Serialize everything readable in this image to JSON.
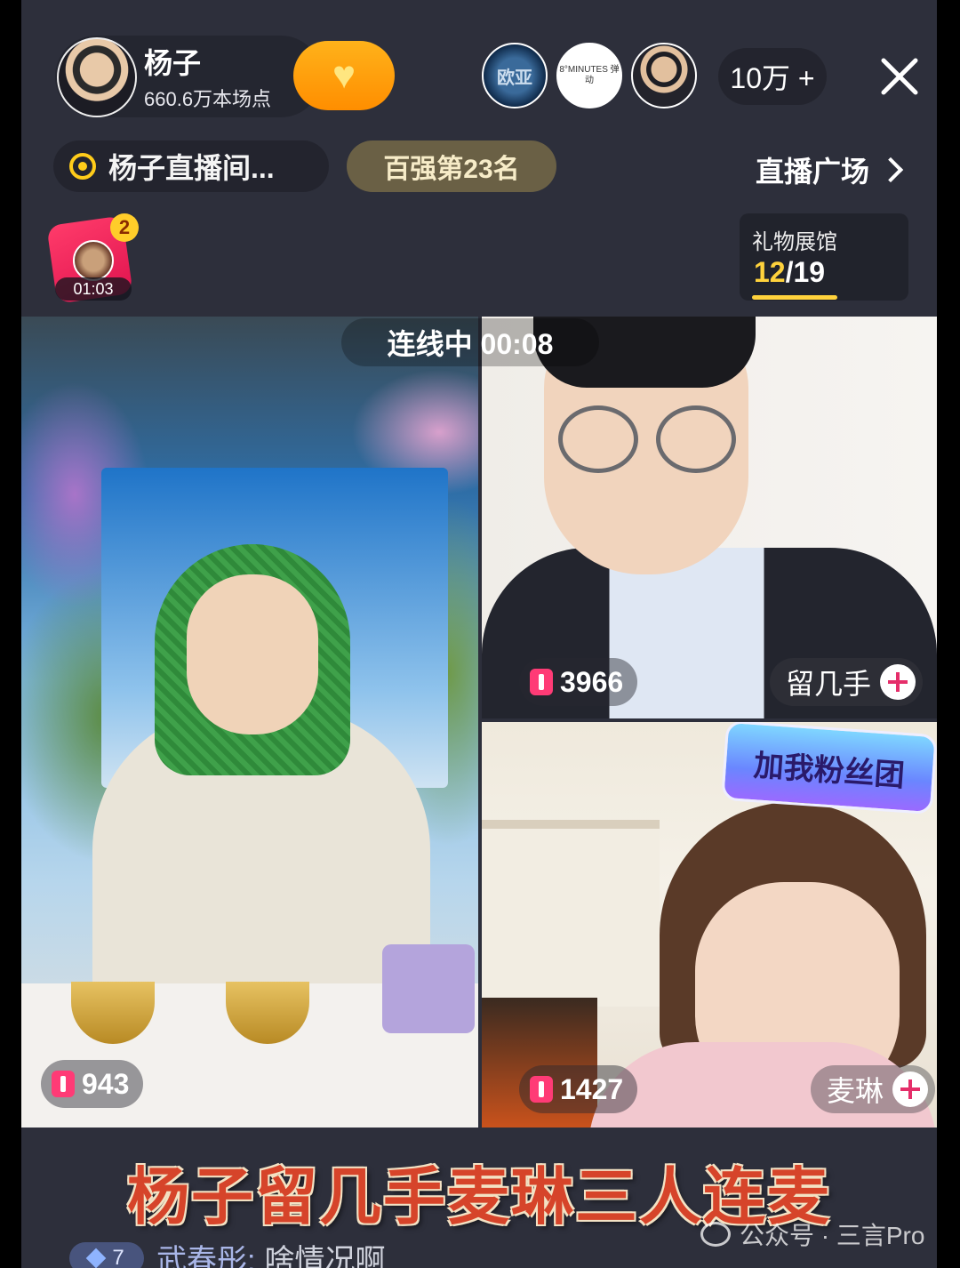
{
  "host": {
    "name": "杨子",
    "points": "660.6万本场点"
  },
  "viewers": {
    "viewer1_label": "欧亚",
    "viewer2_label": "8°MINUTES 弹动",
    "count": "10万 +"
  },
  "room": {
    "name": "杨子直播间...",
    "rank": "百强第23名",
    "plaza": "直播广场"
  },
  "red_packet": {
    "badge": "2",
    "timer": "01:03"
  },
  "gift_hall": {
    "title": "礼物展馆",
    "current": "12",
    "total": "/19"
  },
  "live": {
    "status": "连线中 00:08",
    "panes": [
      {
        "score": "943"
      },
      {
        "score": "3966",
        "name": "留几手"
      },
      {
        "score": "1427",
        "name": "麦琳",
        "banner": "加我粉丝团"
      }
    ]
  },
  "caption": "杨子留几手麦琳三人连麦",
  "comment": {
    "level": "7",
    "user": "武春彤:",
    "text": "啥情况啊"
  },
  "watermark": "公众号 · 三言Pro",
  "colors": {
    "background": "#2d2f3b",
    "follow_button": "#ff9a0a",
    "accent_yellow": "#ffd23c",
    "caption_red": "#d6442a",
    "score_pink": "#ff3b76"
  }
}
